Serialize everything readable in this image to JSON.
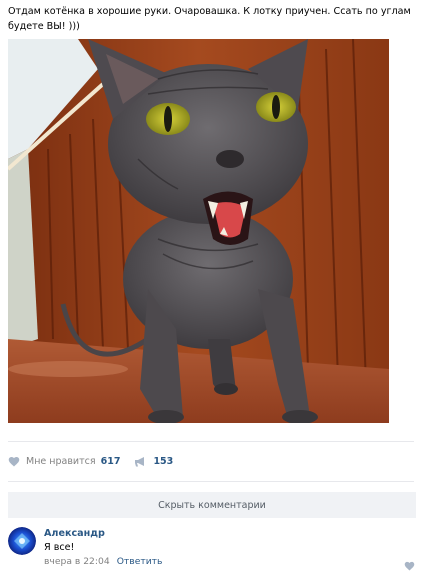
{
  "post": {
    "text": "Отдам котёнка в хорошие руки. Очаровашка. К лотку приучен. Ссать по углам будете ВЫ! )))"
  },
  "actions": {
    "like_label": "Мне нравится",
    "like_count": "617",
    "repost_count": "153"
  },
  "comments": {
    "toggle_label": "Скрыть комментарии",
    "items": [
      {
        "author": "Александр",
        "text": "Я все!",
        "time": "вчера в 22:04",
        "reply_label": "Ответить"
      }
    ]
  },
  "icons": {
    "like": "heart-icon",
    "repost": "megaphone-icon",
    "comment_like": "heart-icon"
  },
  "colors": {
    "link": "#2a5885",
    "muted": "#828282",
    "icon": "#a8b5c6",
    "divider": "#e7e8ec",
    "button_bg": "#f0f2f5"
  }
}
